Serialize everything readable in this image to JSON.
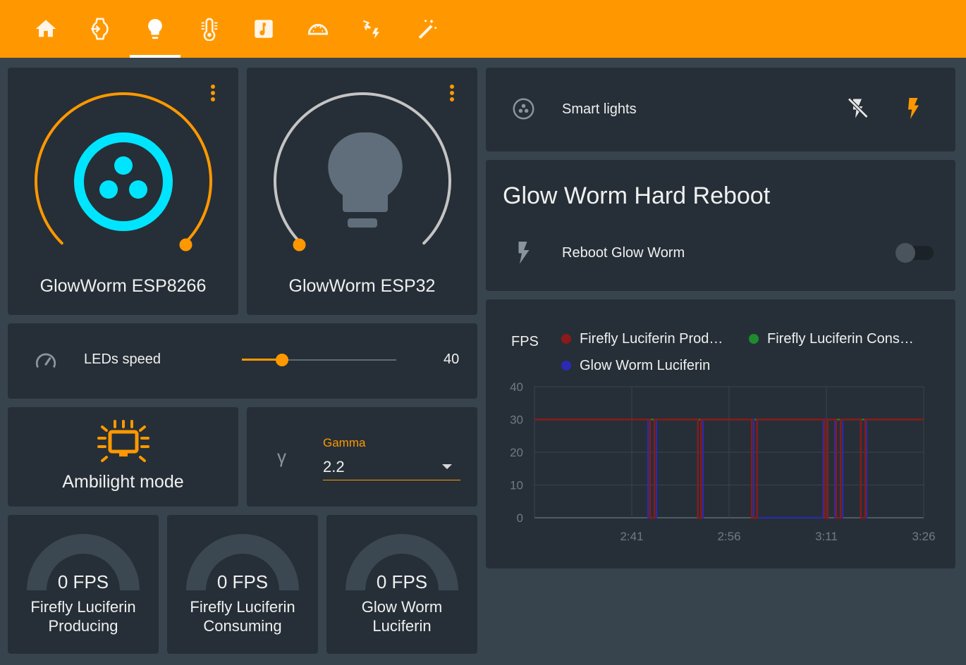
{
  "tabs": [
    {
      "name": "home",
      "icon": "home-icon"
    },
    {
      "name": "login",
      "icon": "watch-login-icon"
    },
    {
      "name": "lights",
      "icon": "lightbulb-icon"
    },
    {
      "name": "thermometer",
      "icon": "thermometer-icon"
    },
    {
      "name": "music",
      "icon": "music-note-icon"
    },
    {
      "name": "gauge",
      "icon": "gauge-icon"
    },
    {
      "name": "flash-auto",
      "icon": "lights-flash-icon"
    },
    {
      "name": "magic",
      "icon": "magic-wand-icon"
    }
  ],
  "active_tab": "lights",
  "lights": [
    {
      "name": "GlowWorm ESP8266",
      "icon": "glowworm-logo-icon",
      "brightness": 0.97,
      "state": "on"
    },
    {
      "name": "GlowWorm ESP32",
      "icon": "lightbulb-icon",
      "brightness": 0.0,
      "state": "off"
    }
  ],
  "leds_speed": {
    "label": "LEDs speed",
    "value": "40",
    "fraction": 0.26
  },
  "ambilight": {
    "label": "Ambilight mode"
  },
  "gamma": {
    "label": "Gamma",
    "value": "2.2",
    "symbol": "γ"
  },
  "fps_gauges": [
    {
      "value": "0 FPS",
      "line1": "Firefly Luciferin",
      "line2": "Producing"
    },
    {
      "value": "0 FPS",
      "line1": "Firefly Luciferin",
      "line2": "Consuming"
    },
    {
      "value": "0 FPS",
      "line1": "Glow Worm",
      "line2": "Luciferin"
    }
  ],
  "smart_lights": {
    "label": "Smart lights"
  },
  "reboot": {
    "title": "Glow Worm Hard Reboot",
    "label": "Reboot Glow Worm",
    "state": "off"
  },
  "colors": {
    "accent": "#ff9800",
    "card": "#262f37",
    "background": "#37434d",
    "cyan": "#00e5ff"
  },
  "chart_data": {
    "type": "line",
    "ylabel": "FPS",
    "ylim": [
      0,
      40
    ],
    "yticks": [
      "0",
      "10",
      "20",
      "30",
      "40"
    ],
    "xticks": [
      "2:41",
      "2:56",
      "3:11",
      "3:26"
    ],
    "x_range": [
      "2:26",
      "3:26"
    ],
    "legend_placement": "top",
    "series": [
      {
        "name": "Firefly Luciferin Prod…",
        "color": "#8b1a1a",
        "points": [
          [
            "2:26",
            30
          ],
          [
            "2:43.8",
            30
          ],
          [
            "2:43.8",
            0
          ],
          [
            "2:44.5",
            0
          ],
          [
            "2:44.5",
            30
          ],
          [
            "2:51.2",
            30
          ],
          [
            "2:51.2",
            0
          ],
          [
            "2:51.7",
            0
          ],
          [
            "2:51.7",
            30
          ],
          [
            "2:59.5",
            30
          ],
          [
            "2:59.5",
            0
          ],
          [
            "3:00.3",
            0
          ],
          [
            "3:00.3",
            30
          ],
          [
            "3:10.7",
            30
          ],
          [
            "3:10.7",
            0
          ],
          [
            "3:11.2",
            0
          ],
          [
            "3:11.2",
            30
          ],
          [
            "3:12.5",
            30
          ],
          [
            "3:12.5",
            0
          ],
          [
            "3:13.2",
            0
          ],
          [
            "3:13.2",
            30
          ],
          [
            "3:16.3",
            30
          ],
          [
            "3:16.3",
            0
          ],
          [
            "3:17.0",
            0
          ],
          [
            "3:17.0",
            30
          ],
          [
            "3:26",
            30
          ]
        ]
      },
      {
        "name": "Firefly Luciferin Cons…",
        "color": "#1e8c2e",
        "points": [
          [
            "2:26",
            30
          ],
          [
            "3:26",
            30
          ]
        ]
      },
      {
        "name": "Glow Worm Luciferin",
        "color": "#2a2ab5",
        "points": [
          [
            "2:26",
            30
          ],
          [
            "2:43.5",
            30
          ],
          [
            "2:43.5",
            0
          ],
          [
            "2:44.8",
            0
          ],
          [
            "2:44.8",
            30
          ],
          [
            "2:51.2",
            30
          ],
          [
            "2:51.2",
            0
          ],
          [
            "2:52.0",
            0
          ],
          [
            "2:52.0",
            30
          ],
          [
            "2:59.8",
            30
          ],
          [
            "2:59.8",
            0
          ],
          [
            "3:10.5",
            0
          ],
          [
            "3:10.5",
            30
          ],
          [
            "3:12.3",
            30
          ],
          [
            "3:12.3",
            0
          ],
          [
            "3:13.5",
            0
          ],
          [
            "3:13.5",
            30
          ],
          [
            "3:16.3",
            30
          ],
          [
            "3:16.3",
            0
          ],
          [
            "3:17.2",
            0
          ],
          [
            "3:17.2",
            30
          ],
          [
            "3:26",
            30
          ]
        ]
      }
    ]
  }
}
